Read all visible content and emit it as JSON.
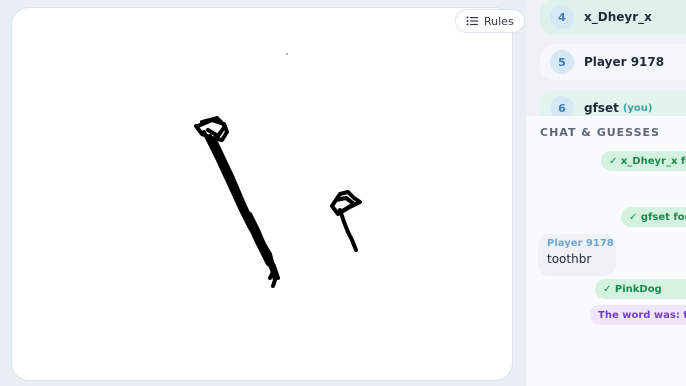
{
  "toolbar": {
    "rules_label": "Rules"
  },
  "players": [
    {
      "rank": "4",
      "name": "x_Dheyr_x",
      "you_tag": ""
    },
    {
      "rank": "5",
      "name": "Player 9178",
      "you_tag": ""
    },
    {
      "rank": "6",
      "name": "gfset",
      "you_tag": "(you)"
    }
  ],
  "chat": {
    "title": "CHAT & GUESSES",
    "messages": [
      {
        "type": "system-correct",
        "text": "✓ x_Dheyr_x fo"
      },
      {
        "type": "system-correct",
        "text": "✓ gfset foun"
      },
      {
        "type": "guess",
        "author": "Player 9178",
        "text": "toothbr"
      },
      {
        "type": "system-correct",
        "text": "✓ PinkDog"
      },
      {
        "type": "system-reveal",
        "text": "The word was: to"
      }
    ]
  },
  "colors": {
    "correct_bg": "#d3f2e0",
    "correct_text": "#1b8a4d",
    "reveal_bg": "#efe6fb",
    "reveal_text": "#7342c2",
    "you_row_bg": "#e3f3ee"
  }
}
